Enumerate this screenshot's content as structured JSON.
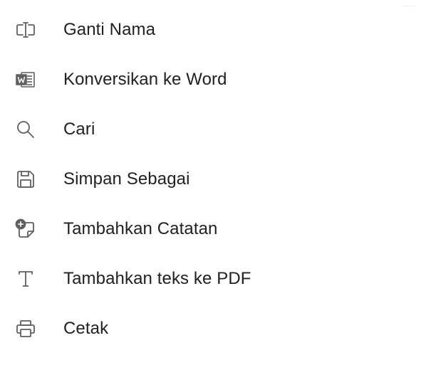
{
  "colors": {
    "background": "#ffffff",
    "text": "#212121",
    "icon": "#5f5f5f"
  },
  "menu": {
    "items": [
      {
        "label": "Ganti Nama",
        "icon": "rename-icon"
      },
      {
        "label": "Konversikan ke Word",
        "icon": "word-icon"
      },
      {
        "label": "Cari",
        "icon": "search-icon"
      },
      {
        "label": "Simpan Sebagai",
        "icon": "save-icon"
      },
      {
        "label": "Tambahkan Catatan",
        "icon": "add-note-icon"
      },
      {
        "label": "Tambahkan teks ke PDF",
        "icon": "text-icon"
      },
      {
        "label": "Cetak",
        "icon": "print-icon"
      }
    ]
  }
}
